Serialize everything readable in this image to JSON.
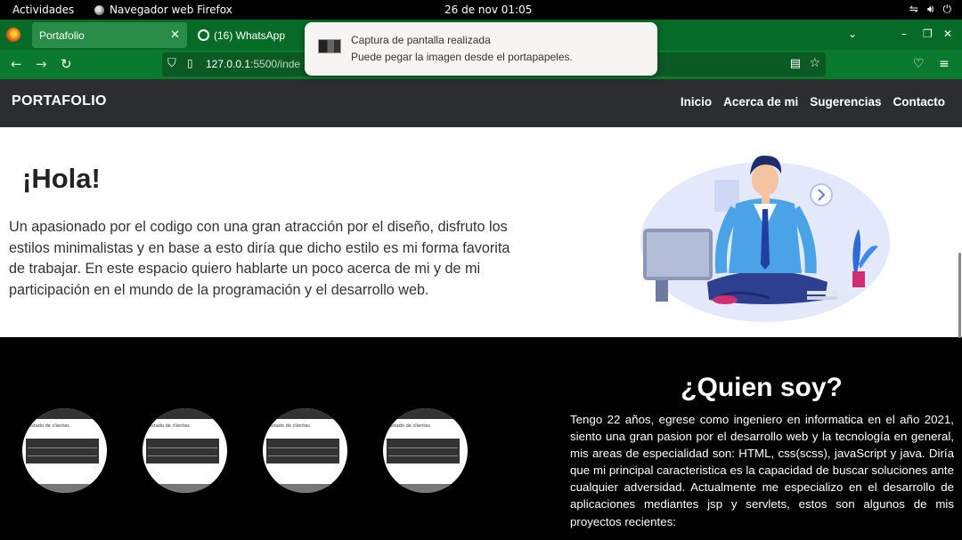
{
  "system": {
    "activities": "Actividades",
    "app_name": "Navegador web Firefox",
    "clock": "26 de nov  01:05"
  },
  "browser": {
    "tabs": [
      {
        "label": "Portafolio",
        "active": true
      },
      {
        "label": "(16) WhatsApp",
        "active": false
      }
    ],
    "url_host": "127.0.0.1",
    "url_rest": ":5500/inde",
    "accent": "#0a7a2e"
  },
  "notification": {
    "title": "Captura de pantalla realizada",
    "body": "Puede pegar la imagen desde el portapapeles."
  },
  "site": {
    "brand": "PORTAFOLIO",
    "menu": [
      "Inicio",
      "Acerca de mi",
      "Sugerencias",
      "Contacto"
    ]
  },
  "hero": {
    "greeting": "¡Hola!",
    "intro": "Un apasionado por el codigo con una gran atracción por el diseño, disfruto los estilos minimalistas y en base a esto diría que dicho estilo es mi forma favorita de trabajar. En este espacio quiero hablarte un poco acerca de mi y de mi participación en el mundo de la programación y el desarrollo web."
  },
  "about": {
    "title": "¿Quien soy?",
    "text": "Tengo 22 años, egrese como ingeniero en informatica en el año 2021, siento una gran pasion por el desarrollo web y la tecnología en general, mis areas de especialidad son: HTML, css(scss), javaScript y java. Diría que mi principal caracteristica es la capacidad de buscar soluciones ante cualquier adversidad. Actualmente me especializo en el desarrollo de aplicaciones mediantes jsp y servlets, estos son algunos de mis proyectos recientes:"
  }
}
